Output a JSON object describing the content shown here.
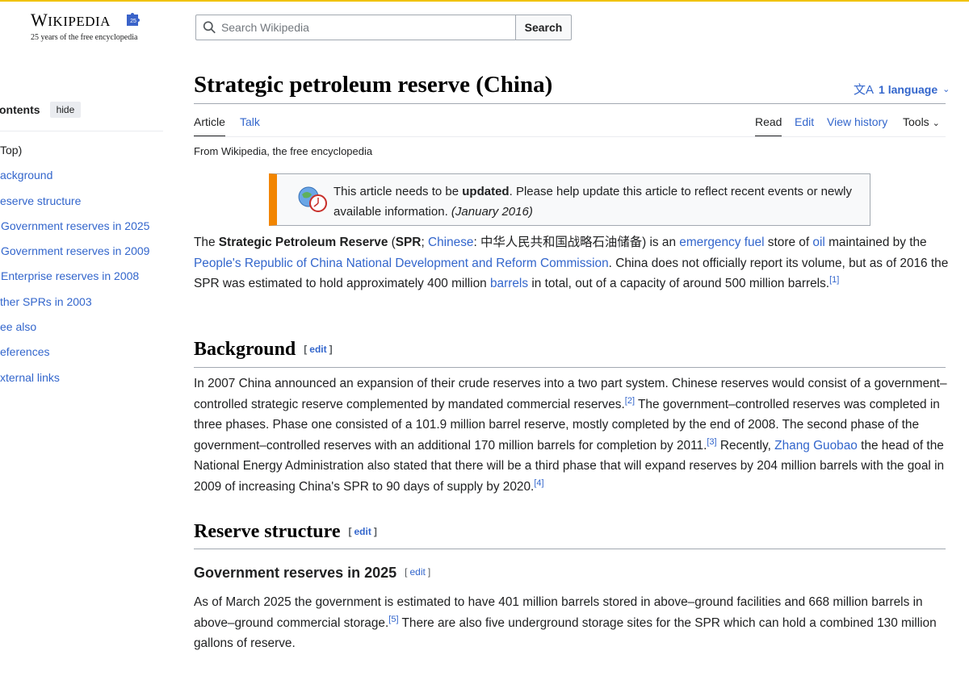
{
  "logo": {
    "wordmark_first": "W",
    "wordmark_rest": "IKIPEDIA",
    "tagline": "25 years of the free encyclopedia",
    "badge_text": "25"
  },
  "search": {
    "placeholder": "Search Wikipedia",
    "button_label": "Search"
  },
  "toc": {
    "title": "ontents",
    "hide_label": "hide",
    "items": [
      {
        "label": "Top)",
        "kind": "top"
      },
      {
        "label": "ackground",
        "kind": "l1"
      },
      {
        "label": "eserve structure",
        "kind": "l1"
      },
      {
        "label": "Government reserves in 2025",
        "kind": "l2"
      },
      {
        "label": "Government reserves in 2009",
        "kind": "l2"
      },
      {
        "label": "Enterprise reserves in 2008",
        "kind": "l2"
      },
      {
        "label": "ther SPRs in 2003",
        "kind": "l1"
      },
      {
        "label": "ee also",
        "kind": "l1"
      },
      {
        "label": "eferences",
        "kind": "l1"
      },
      {
        "label": "xternal links",
        "kind": "l1"
      }
    ]
  },
  "article": {
    "title": "Strategic petroleum reserve (China)",
    "language_label": "1 language",
    "tabs_left": [
      "Article",
      "Talk"
    ],
    "tabs_right": [
      "Read",
      "Edit",
      "View history",
      "Tools"
    ],
    "from": "From Wikipedia, the free encyclopedia",
    "notice": {
      "pre": "This article needs to be ",
      "bold": "updated",
      "post": ". Please help update this article to reflect recent events or newly available information. ",
      "date": "(January 2016)"
    },
    "intro": {
      "t1": "The ",
      "b1": "Strategic Petroleum Reserve",
      "t2": " (",
      "b2": "SPR",
      "t3": "; ",
      "l_chinese": "Chinese",
      "t4": ": 中华人民共和国战略石油储备) is an ",
      "l_emergency": "emergency fuel",
      "t5": " store of ",
      "l_oil": "oil",
      "t6": " maintained by the ",
      "l_ndrc": "People's Republic of China National Development and Reform Commission",
      "t7": ". China does not officially report its volume, but as of 2016 the SPR was estimated to hold approximately 400 million ",
      "l_barrels": "barrels",
      "t8": " in total, out of a capacity of around 500 million barrels.",
      "ref1": "[1]"
    },
    "edit_label": "edit",
    "background": {
      "heading": "Background",
      "t1": "In 2007 China announced an expansion of their crude reserves into a two part system. Chinese reserves would consist of a government–controlled strategic reserve complemented by mandated commercial reserves.",
      "ref2": "[2]",
      "t2": " The government–controlled reserves was completed in three phases. Phase one consisted of a 101.9 million barrel reserve, mostly completed by the end of 2008. The second phase of the government–controlled reserves with an additional 170 million barrels for completion by 2011.",
      "ref3": "[3]",
      "t3": " Recently, ",
      "l_zhang": "Zhang Guobao",
      "t4": " the head of the National Energy Administration also stated that there will be a third phase that will expand reserves by 204 million barrels with the goal in 2009 of increasing China's SPR to 90 days of supply by 2020.",
      "ref4": "[4]"
    },
    "reserve": {
      "heading": "Reserve structure"
    },
    "gov2025": {
      "heading": "Government reserves in 2025",
      "t1": "As of March 2025 the government is estimated to have 401 million barrels stored in above–ground facilities and 668 million barrels in above–ground commercial storage.",
      "ref5": "[5]",
      "t2": " There are also five underground storage sites for the SPR which can hold a combined 130 million gallons of reserve."
    }
  }
}
